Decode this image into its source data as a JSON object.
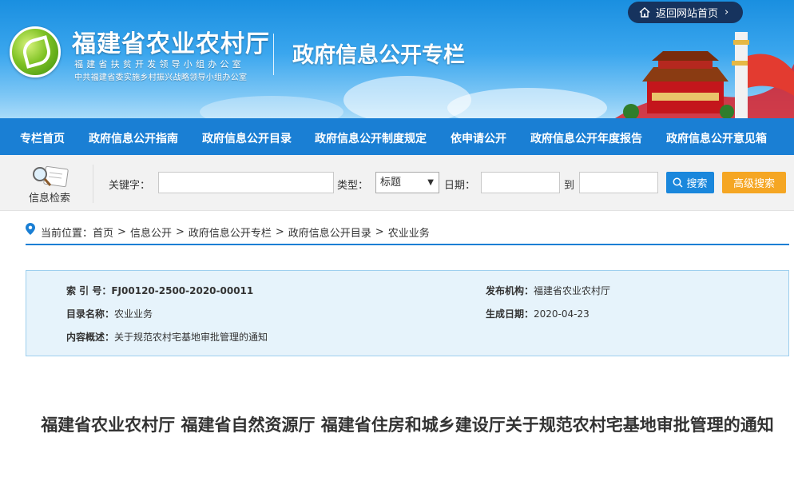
{
  "header": {
    "site_name": "福建省农业农村厅",
    "sub_line1": "福建省扶贫开发领导小组办公室",
    "sub_line2": "中共福建省委实施乡村振兴战略领导小组办公室",
    "column_title": "政府信息公开专栏",
    "return_label": "返回网站首页"
  },
  "nav": {
    "items": [
      {
        "label": "专栏首页"
      },
      {
        "label": "政府信息公开指南"
      },
      {
        "label": "政府信息公开目录"
      },
      {
        "label": "政府信息公开制度规定"
      },
      {
        "label": "依申请公开"
      },
      {
        "label": "政府信息公开年度报告"
      },
      {
        "label": "政府信息公开意见箱"
      }
    ]
  },
  "search": {
    "section_label": "信息检索",
    "keyword_label": "关键字：",
    "keyword_value": "",
    "type_label": "类型：",
    "type_selected": "标题",
    "date_label": "日期：",
    "date_from": "",
    "to_label": "到",
    "date_to": "",
    "search_button": "搜索",
    "advanced_button": "高级搜索"
  },
  "breadcrumb": {
    "prefix": "当前位置：",
    "items": [
      "首页",
      "信息公开",
      "政府信息公开专栏",
      "政府信息公开目录",
      "农业业务"
    ],
    "separator": ">"
  },
  "info": {
    "index_key": "索 引 号：",
    "index_value": "FJ00120-2500-2020-00011",
    "publisher_key": "发布机构：",
    "publisher_value": "福建省农业农村厅",
    "catalog_key": "目录名称：",
    "catalog_value": "农业业务",
    "date_key": "生成日期：",
    "date_value": "2020-04-23",
    "summary_key": "内容概述：",
    "summary_value": "关于规范农村宅基地审批管理的通知"
  },
  "article": {
    "title": "福建省农业农村厅 福建省自然资源厅 福建省住房和城乡建设厅关于规范农村宅基地审批管理的通知"
  },
  "colors": {
    "nav_bg": "#1a7fd4",
    "search_btn": "#1a87dc",
    "advanced_btn": "#f5a623",
    "info_bg": "#e6f3fb",
    "return_btn": "#16335e"
  }
}
